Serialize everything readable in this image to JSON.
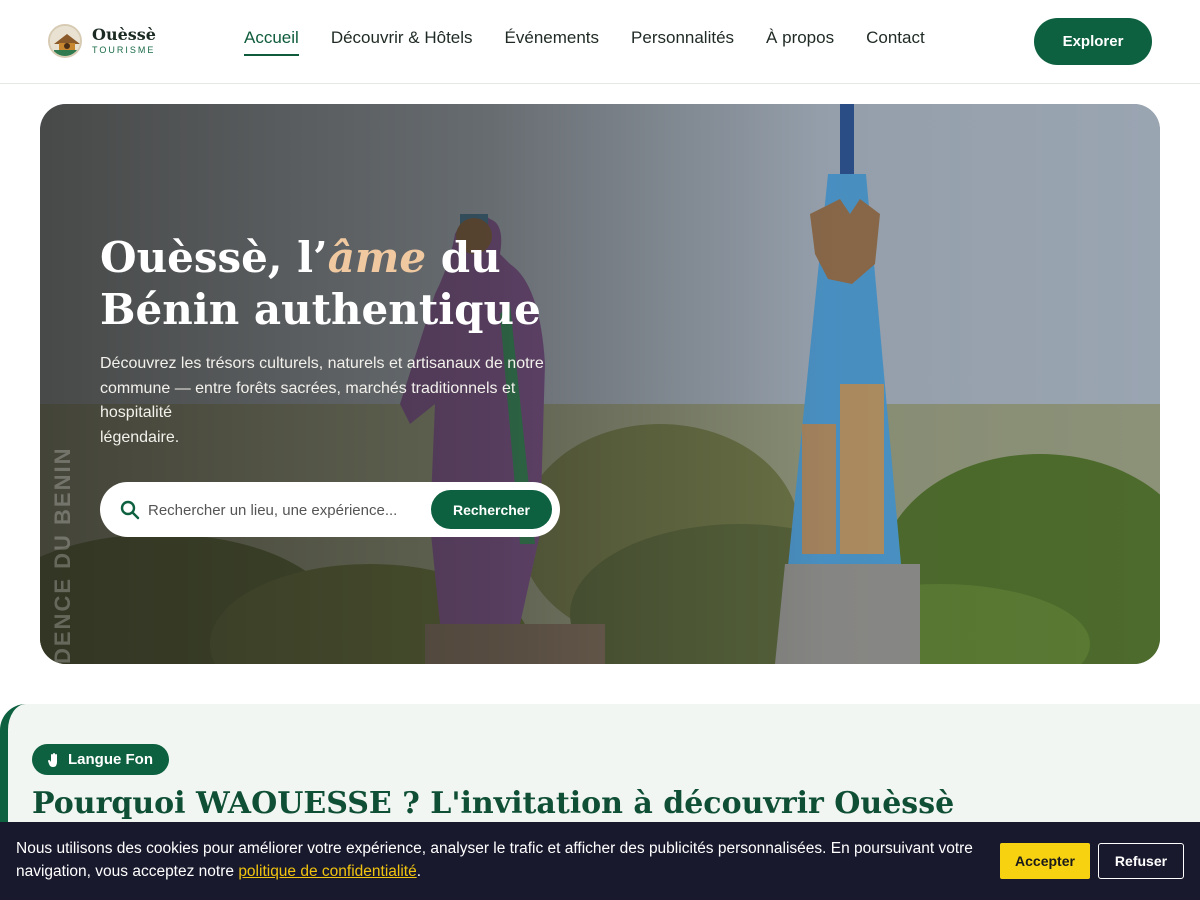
{
  "header": {
    "logo_name": "Ouèssè",
    "logo_sub": "TOURISME",
    "nav": [
      {
        "label": "Accueil"
      },
      {
        "label": "Découvrir & Hôtels"
      },
      {
        "label": "Événements"
      },
      {
        "label": "Personnalités"
      },
      {
        "label": "À propos"
      },
      {
        "label": "Contact"
      }
    ],
    "cta_label": "Explorer"
  },
  "hero": {
    "title_part1": "Ouèssè, l’",
    "title_accent": "âme",
    "title_part2": " du",
    "title_line2": "Bénin authentique",
    "description_line1": "Découvrez les trésors culturels, naturels et artisanaux de notre commune — entre forêts sacrées, marchés traditionnels et hospitalité",
    "description_line2": "légendaire.",
    "search_placeholder": "Rechercher un lieu, une expérience...",
    "search_button": "Rechercher",
    "vertical_text": "DENCE DU BENIN"
  },
  "section": {
    "badge": "Langue Fon",
    "title": "Pourquoi WAOUESSE ? L'invitation à découvrir Ouèssè"
  },
  "cookie": {
    "text": "Nous utilisons des cookies pour améliorer votre expérience, analyser le trafic et afficher des publicités personnalisées. En poursuivant votre navigation, vous acceptez notre ",
    "link": "politique de confidentialité",
    "text_end": ".",
    "accept": "Accepter",
    "refuse": "Refuser"
  },
  "colors": {
    "brand_green": "#0d6140",
    "accent_gold": "#f0c9a0",
    "cookie_bg": "#19192e",
    "accept_yellow": "#f6d211"
  }
}
